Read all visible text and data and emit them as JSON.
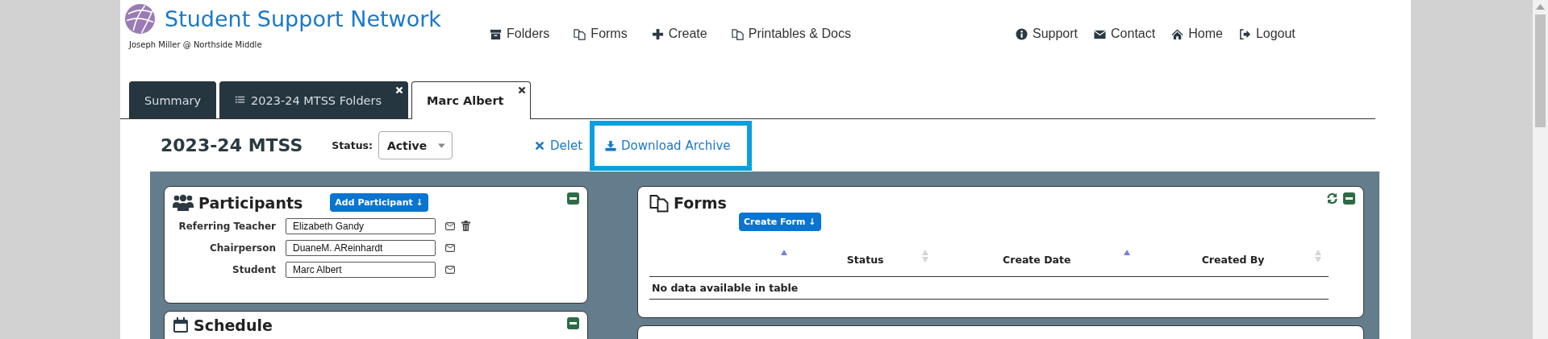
{
  "header": {
    "title": "Student Support Network",
    "user": "Joseph Miller @ Northside Middle"
  },
  "nav": [
    {
      "label": "Folders",
      "kind": "archive"
    },
    {
      "label": "Forms",
      "kind": "copy"
    },
    {
      "label": "Create",
      "kind": "plus"
    },
    {
      "label": "Printables & Docs",
      "kind": "copy"
    }
  ],
  "user_nav": [
    {
      "label": "Support",
      "kind": "info"
    },
    {
      "label": "Contact",
      "kind": "envelope"
    },
    {
      "label": "Home",
      "kind": "home"
    },
    {
      "label": "Logout",
      "kind": "logout"
    }
  ],
  "tabs": [
    {
      "label": "Summary",
      "kind": "plain",
      "selected": false,
      "closable": false
    },
    {
      "label": "2023-24 MTSS Folders",
      "kind": "list",
      "selected": false,
      "closable": true
    },
    {
      "label": "Marc Albert",
      "kind": "plain",
      "selected": true,
      "closable": true
    }
  ],
  "record": {
    "title": "2023-24 MTSS",
    "status_label": "Status:",
    "status": "Active",
    "actions": [
      {
        "label": "Delet",
        "kind": "delete",
        "highlighted": false
      },
      {
        "label": "Download Archive",
        "kind": "download",
        "highlighted": true
      }
    ]
  },
  "participants": {
    "title": "Participants",
    "add_button": "Add Participant ↓",
    "rows": [
      {
        "role": "Referring Teacher",
        "name": "Elizabeth Gandy",
        "deletable": true
      },
      {
        "role": "Chairperson",
        "name": "DuaneM. AReinhardt",
        "deletable": false
      },
      {
        "role": "Student",
        "name": "Marc Albert",
        "deletable": false
      }
    ]
  },
  "schedule": {
    "title": "Schedule"
  },
  "forms": {
    "title": "Forms",
    "create_button": "Create Form ↓",
    "columns": [
      {
        "sorted": true
      },
      {
        "label": "Status",
        "sorted": false
      },
      {
        "label": "Create Date",
        "sorted": true
      },
      {
        "label": "Created By",
        "sorted": false
      }
    ],
    "empty_message": "No data available in table"
  }
}
